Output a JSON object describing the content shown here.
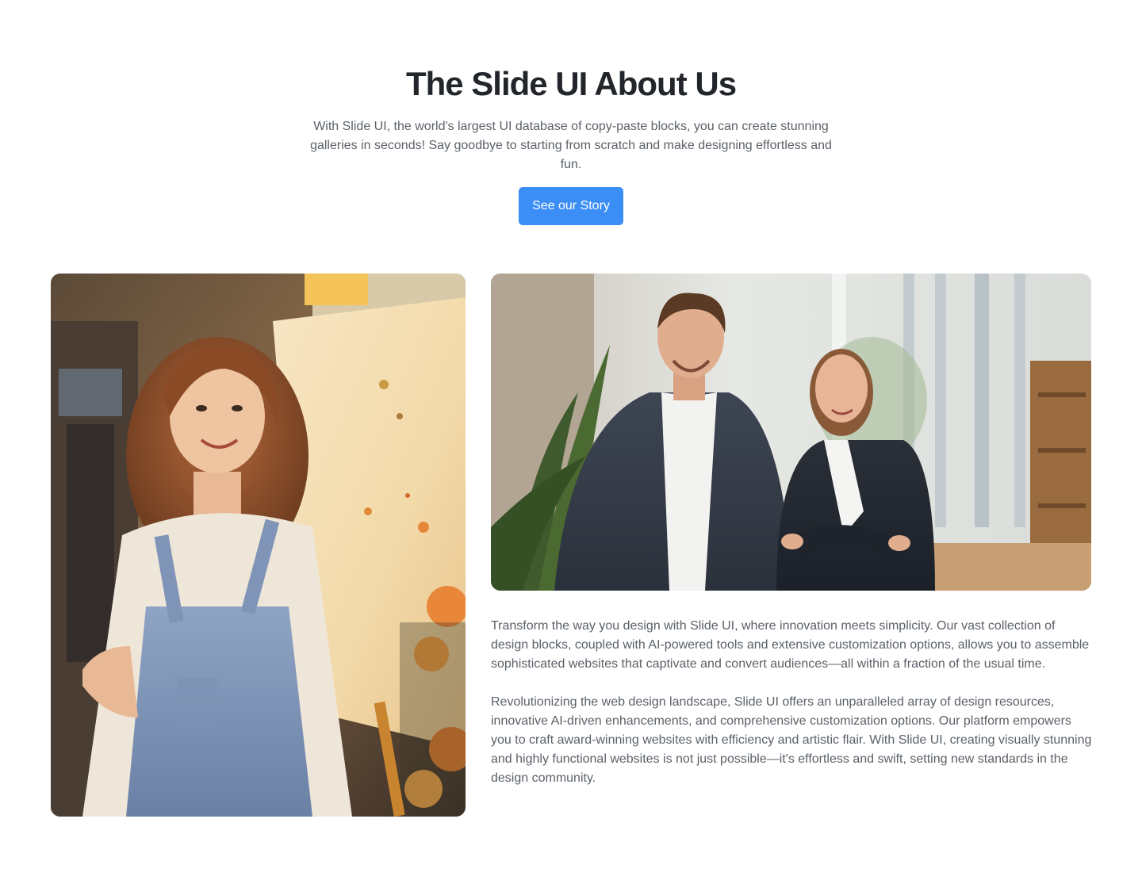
{
  "hero": {
    "title": "The Slide UI About Us",
    "subtitle": "With Slide UI, the world's largest UI database of copy-paste blocks, you can create stunning galleries in seconds! Say goodbye to starting from scratch and make designing effortless and fun.",
    "cta_label": "See our Story"
  },
  "images": {
    "left": {
      "icon": "portrait-painter-photo"
    },
    "right": {
      "icon": "business-duo-photo"
    }
  },
  "content": {
    "paragraph_1": "Transform the way you design with Slide UI, where innovation meets simplicity. Our vast collection of design blocks, coupled with AI-powered tools and extensive customization options, allows you to assemble sophisticated websites that captivate and convert audiences—all within a fraction of the usual time.",
    "paragraph_2": "Revolutionizing the web design landscape, Slide UI offers an unparalleled array of design resources, innovative AI-driven enhancements, and comprehensive customization options. Our platform empowers you to craft award-winning websites with efficiency and artistic flair. With Slide UI, creating visually stunning and highly functional websites is not just possible—it's effortless and swift, setting new standards in the design community."
  },
  "colors": {
    "accent": "#3b8ef5",
    "heading": "#22262b",
    "body": "#5b6169"
  }
}
